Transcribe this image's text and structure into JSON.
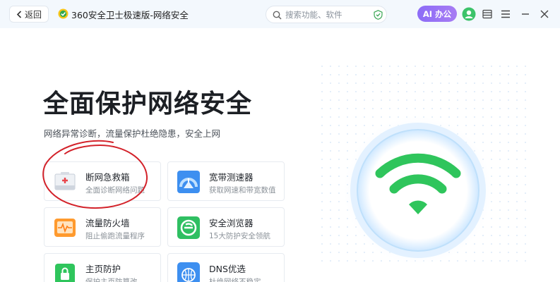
{
  "titlebar": {
    "back_label": "返回",
    "app_title": "360安全卫士极速版-网络安全",
    "search_placeholder": "搜索功能、软件",
    "ai_label": "AI 办公",
    "icons": [
      "back-arrow-icon",
      "app-logo-icon",
      "search-icon",
      "shield-check-icon",
      "avatar-icon",
      "skin-icon",
      "menu-icon",
      "minimize-icon",
      "close-icon"
    ]
  },
  "main": {
    "headline": "全面保护网络安全",
    "subline": "网络异常诊断，流量保护杜绝隐患，安全上网",
    "cards": [
      {
        "title": "断网急救箱",
        "desc": "全面诊断网络问题",
        "icon": "first-aid-kit-icon"
      },
      {
        "title": "宽带测速器",
        "desc": "获取网速和带宽数值",
        "icon": "speedometer-icon"
      },
      {
        "title": "流量防火墙",
        "desc": "阻止偷跑流量程序",
        "icon": "firewall-icon"
      },
      {
        "title": "安全浏览器",
        "desc": "15大防护安全领航",
        "icon": "browser-icon"
      },
      {
        "title": "主页防护",
        "desc": "保护主页防篡改",
        "icon": "homepage-lock-icon"
      },
      {
        "title": "DNS优选",
        "desc": "杜绝网络不稳定",
        "icon": "dns-globe-icon"
      }
    ]
  },
  "colors": {
    "titlebar_bg": "#f3f8fd",
    "accent_green": "#2fc55c",
    "ai_purple": "#8c6cf7",
    "annotation_red": "#d3222a"
  }
}
